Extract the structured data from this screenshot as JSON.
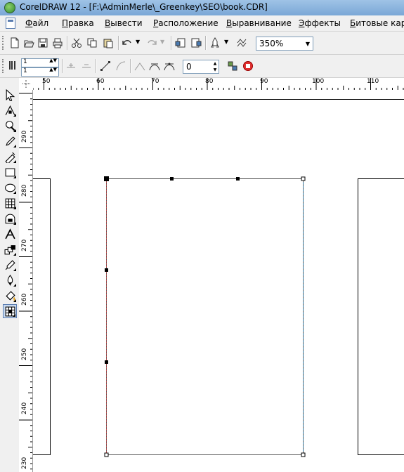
{
  "titlebar": {
    "title": "CorelDRAW 12 - [F:\\AdminMerle\\_Greenkey\\SEO\\book.CDR]"
  },
  "menu": [
    {
      "key": "Ф",
      "rest": "айл"
    },
    {
      "key": "П",
      "rest": "равка"
    },
    {
      "key": "В",
      "rest": "ывести"
    },
    {
      "key": "Р",
      "rest": "асположение"
    },
    {
      "key": "В",
      "rest": "ыравнивание"
    },
    {
      "key": "Э",
      "rest": "ффекты"
    },
    {
      "key": "Б",
      "rest": "итовые карты"
    }
  ],
  "toolbar": {
    "zoom_value": "350%"
  },
  "property_bar": {
    "outline_1": "1",
    "outline_2": "1",
    "nodes_value": "0"
  },
  "rulers": {
    "horizontal": [
      "50",
      "60",
      "70",
      "80",
      "90",
      "100",
      "110"
    ],
    "vertical": [
      "290",
      "280",
      "270",
      "260",
      "250",
      "240",
      "230"
    ]
  },
  "toolbox": {
    "icons": [
      "pick-tool-icon",
      "shape-tool-icon",
      "zoom-tool-icon",
      "freehand-tool-icon",
      "smart-fill-tool-icon",
      "rectangle-tool-icon",
      "ellipse-tool-icon",
      "polygon-tool-icon",
      "basic-shapes-tool-icon",
      "text-tool-icon",
      "interactive-blend-tool-icon",
      "eyedropper-tool-icon",
      "outline-tool-icon",
      "fill-tool-icon",
      "interactive-fill-tool-icon"
    ]
  }
}
